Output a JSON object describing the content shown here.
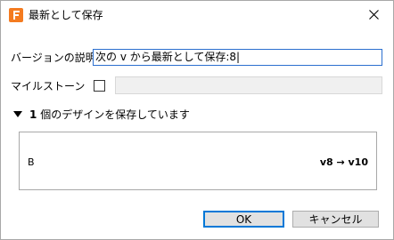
{
  "window": {
    "title": "最新として保存",
    "icon": "fusion-app-icon",
    "accent_color": "#f47b20"
  },
  "form": {
    "description_label": "バージョンの説明",
    "description_value": "次の v から最新として保存:8|",
    "milestone_label": "マイルストーン",
    "milestone_checked": false,
    "milestone_value": ""
  },
  "summary": {
    "count": "1",
    "text": "個のデザインを保存しています"
  },
  "designs": [
    {
      "name": "B",
      "version": "v8 → v10"
    }
  ],
  "buttons": {
    "ok": "OK",
    "cancel": "キャンセル"
  }
}
